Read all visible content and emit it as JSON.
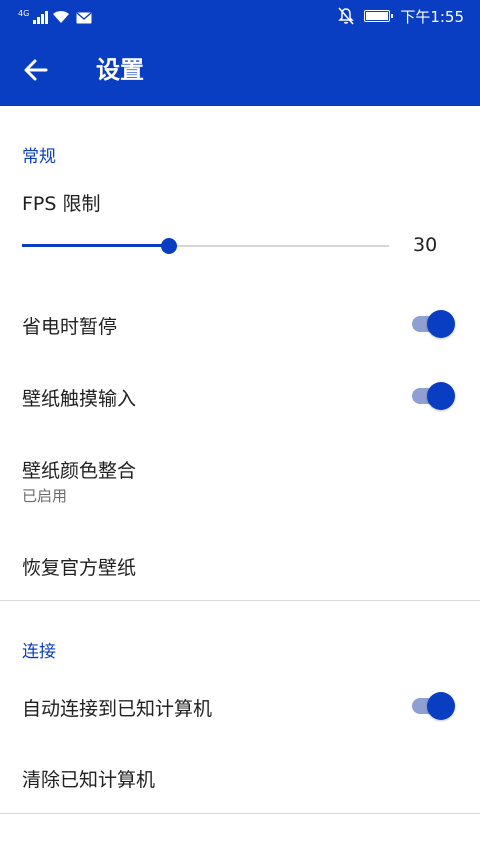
{
  "status_bar": {
    "network": "4G",
    "time": "下午1:55",
    "icons": [
      "signal-icon",
      "wifi-icon",
      "mail-icon",
      "mute-notification-icon",
      "battery-icon"
    ]
  },
  "app_bar": {
    "title": "设置",
    "back_icon": "arrow-left-icon"
  },
  "sections": {
    "general": {
      "header": "常规",
      "fps": {
        "label": "FPS 限制",
        "value": "30",
        "slider_fraction": 0.4
      },
      "pause_on_power_save": {
        "label": "省电时暂停",
        "enabled": true
      },
      "wallpaper_touch_input": {
        "label": "壁纸触摸输入",
        "enabled": true
      },
      "wallpaper_color_integration": {
        "label": "壁纸颜色整合",
        "summary": "已启用"
      },
      "restore_official_wallpaper": {
        "label": "恢复官方壁纸"
      }
    },
    "connection": {
      "header": "连接",
      "auto_connect": {
        "label": "自动连接到已知计算机",
        "enabled": true
      },
      "clear_known": {
        "label": "清除已知计算机"
      }
    }
  },
  "colors": {
    "primary": "#0a3ec2",
    "switch_track": "#8e9fd1",
    "slider_inactive": "#d6d6d6",
    "divider": "#d9d9d9",
    "secondary_text": "#6b6b6b"
  }
}
